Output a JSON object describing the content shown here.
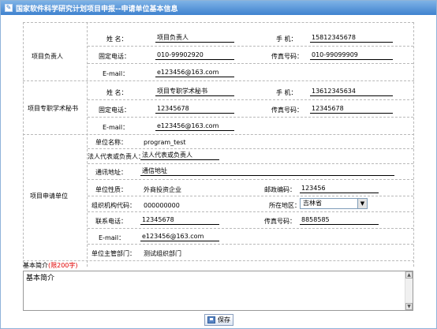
{
  "window": {
    "title": "国家软件科学研究计划项目申报--申请单位基本信息"
  },
  "leader": {
    "section_label": "项目负责人",
    "name_label": "姓  名：",
    "name_value": "项目负责人",
    "mobile_label": "手  机：",
    "mobile_value": "15812345678",
    "phone_label": "固定电话：",
    "phone_value": "010-99902920",
    "fax_label": "传真号码：",
    "fax_value": "010-99099909",
    "email_label": "E-mail：",
    "email_value": "e123456@163.com"
  },
  "secretary": {
    "section_label": "项目专职学术秘书",
    "name_label": "姓  名：",
    "name_value": "项目专职学术秘书",
    "mobile_label": "手  机：",
    "mobile_value": "13612345634",
    "phone_label": "固定电话：",
    "phone_value": "12345678",
    "fax_label": "传真号码：",
    "fax_value": "12345678",
    "email_label": "E-mail：",
    "email_value": "e123456@163.com"
  },
  "unit": {
    "section_label": "项目申请单位",
    "name_label": "单位名称：",
    "name_value": "program_test",
    "legal_label": "法人代表或负责人：",
    "legal_value": "法人代表或负责人",
    "address_label": "通讯地址：",
    "address_value": "通信地址",
    "nature_label": "单位性质：",
    "nature_value": "外商投资企业",
    "postcode_label": "邮政编码：",
    "postcode_value": "123456",
    "org_code_label": "组织机构代码：",
    "org_code_value": "000000000",
    "region_label": "所在地区：",
    "region_value": "吉林省",
    "contact_label": "联系电话：",
    "contact_value": "12345678",
    "fax_label": "传真号码：",
    "fax_value": "8858585",
    "email_label": "E-mail：",
    "email_value": "e123456@163.com",
    "dept_label": "单位主管部门：",
    "dept_value": "测试组织部门"
  },
  "intro": {
    "label": "基本简介",
    "limit_note": "(限200字)",
    "value": "基本简介"
  },
  "actions": {
    "save_label": "保存"
  },
  "icons": [
    "window-icon",
    "save-icon",
    "chevron-down-icon",
    "scroll-up-icon",
    "scroll-down-icon"
  ]
}
